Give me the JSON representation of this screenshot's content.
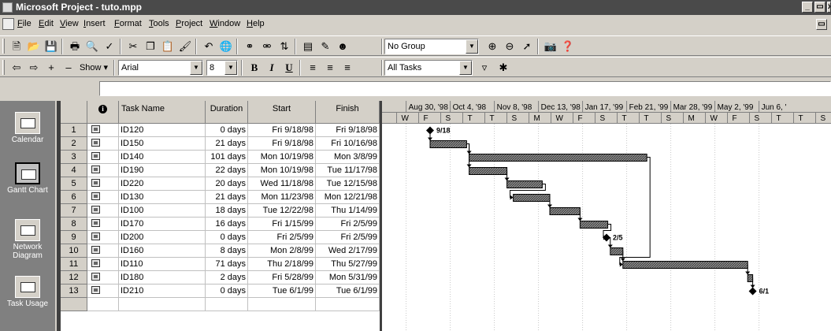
{
  "window": {
    "title": "Microsoft Project - tuto.mpp"
  },
  "menu": {
    "items": [
      "File",
      "Edit",
      "View",
      "Insert",
      "Format",
      "Tools",
      "Project",
      "Window",
      "Help"
    ]
  },
  "toolbar": {
    "group_value": "No Group",
    "font_value": "Arial",
    "size_value": "8",
    "filter_value": "All Tasks",
    "show_label": "Show",
    "bold_label": "B",
    "italic_label": "I",
    "underline_label": "U"
  },
  "viewbar": {
    "items": [
      {
        "label": "Calendar",
        "icon": "calendar-icon"
      },
      {
        "label": "Gantt Chart",
        "icon": "gantt-chart-icon"
      },
      {
        "label": "Network Diagram",
        "icon": "network-diagram-icon"
      },
      {
        "label": "Task Usage",
        "icon": "task-usage-icon"
      }
    ]
  },
  "table": {
    "headers": {
      "indicator": "i",
      "name": "Task Name",
      "duration": "Duration",
      "start": "Start",
      "finish": "Finish"
    },
    "rows": [
      {
        "id": "1",
        "name": "ID120",
        "duration": "0 days",
        "start": "Fri 9/18/98",
        "finish": "Fri 9/18/98"
      },
      {
        "id": "2",
        "name": "ID150",
        "duration": "21 days",
        "start": "Fri 9/18/98",
        "finish": "Fri 10/16/98"
      },
      {
        "id": "3",
        "name": "ID140",
        "duration": "101 days",
        "start": "Mon 10/19/98",
        "finish": "Mon 3/8/99"
      },
      {
        "id": "4",
        "name": "ID190",
        "duration": "22 days",
        "start": "Mon 10/19/98",
        "finish": "Tue 11/17/98"
      },
      {
        "id": "5",
        "name": "ID220",
        "duration": "20 days",
        "start": "Wed 11/18/98",
        "finish": "Tue 12/15/98"
      },
      {
        "id": "6",
        "name": "ID130",
        "duration": "21 days",
        "start": "Mon 11/23/98",
        "finish": "Mon 12/21/98"
      },
      {
        "id": "7",
        "name": "ID100",
        "duration": "18 days",
        "start": "Tue 12/22/98",
        "finish": "Thu 1/14/99"
      },
      {
        "id": "8",
        "name": "ID170",
        "duration": "16 days",
        "start": "Fri 1/15/99",
        "finish": "Fri 2/5/99"
      },
      {
        "id": "9",
        "name": "ID200",
        "duration": "0 days",
        "start": "Fri 2/5/99",
        "finish": "Fri 2/5/99"
      },
      {
        "id": "10",
        "name": "ID160",
        "duration": "8 days",
        "start": "Mon 2/8/99",
        "finish": "Wed 2/17/99"
      },
      {
        "id": "11",
        "name": "ID110",
        "duration": "71 days",
        "start": "Thu 2/18/99",
        "finish": "Thu 5/27/99"
      },
      {
        "id": "12",
        "name": "ID180",
        "duration": "2 days",
        "start": "Fri 5/28/99",
        "finish": "Mon 5/31/99"
      },
      {
        "id": "13",
        "name": "ID210",
        "duration": "0 days",
        "start": "Tue 6/1/99",
        "finish": "Tue 6/1/99"
      }
    ]
  },
  "gantt": {
    "weeks": [
      "98",
      "Aug 30, '98",
      "Oct 4, '98",
      "Nov 8, '98",
      "Dec 13, '98",
      "Jan 17, '99",
      "Feb 21, '99",
      "Mar 28, '99",
      "May 2, '99",
      "Jun 6, '"
    ],
    "days": [
      "W",
      "F",
      "S",
      "T",
      "T",
      "S",
      "M",
      "W",
      "F",
      "S",
      "T",
      "T",
      "S",
      "M",
      "W",
      "F",
      "S",
      "T",
      "T",
      "S"
    ],
    "milestone_labels": {
      "1": "9/18",
      "9": "2/5",
      "13": "6/1"
    }
  }
}
